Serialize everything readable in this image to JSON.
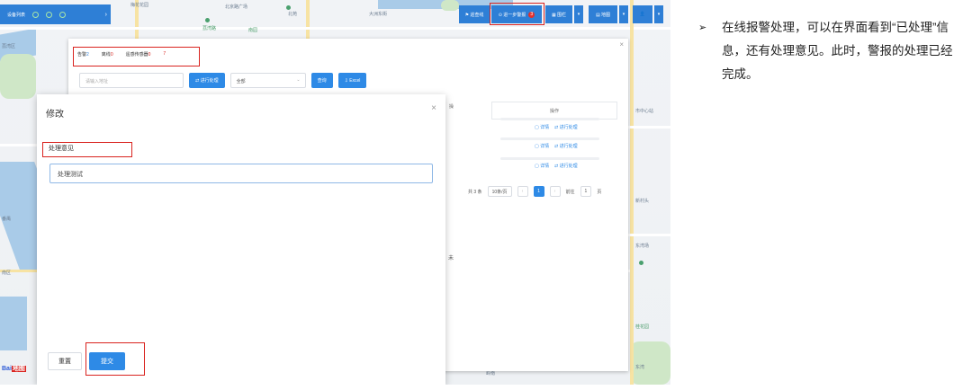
{
  "topbar": {
    "left_title": "设备列表",
    "left_chevron": "›",
    "btn_route": "⚑ 巡查线",
    "btn_alarm": "⊙ 进一步警报",
    "alarm_badge": "3",
    "btn_fence": "▦ 围栏",
    "btn_layers": "▤ 地图",
    "btn_user": "👤"
  },
  "map_labels": [
    "梅花花园",
    "北京路广场",
    "北苑",
    "大洲东街",
    "荔湾路",
    "荔湾区",
    "南园",
    "市中心站",
    "新村头",
    "东湾场",
    "桂花园",
    "番禺",
    "南区",
    "岭南",
    "东湾"
  ],
  "panel": {
    "tabs": [
      {
        "label": "告警",
        "count": "2"
      },
      {
        "label": "离线",
        "count": "0"
      },
      {
        "label": "遥感传感器",
        "count": "0"
      }
    ],
    "tab_extra": "7",
    "search_placeholder": "请输入地址",
    "btn_process": "⇄ 进行处理",
    "select_value": "全部",
    "btn_query": "查询",
    "btn_export": "⇩ Excel",
    "header_left": "操",
    "header_action": "操作",
    "row_actions": [
      {
        "detail": "▢ 详情",
        "process": "⇄ 进行处理"
      },
      {
        "detail": "▢ 详情",
        "process": "⇄ 进行处理"
      },
      {
        "detail": "▢ 详情",
        "process": "⇄ 进行处理"
      }
    ],
    "pager": {
      "total": "共 3 条",
      "page_size": "10条/页",
      "current": "1",
      "goto_label": "前往",
      "goto_value": "1",
      "page_unit": "页"
    },
    "close": "×"
  },
  "modal": {
    "title": "修改",
    "close": "×",
    "field_label": "处理意见",
    "field_value": "处理测试",
    "btn_reset": "重置",
    "btn_submit": "提交"
  },
  "stray_text": "未",
  "baidu_logo": "Bai",
  "baidu_logo_red": "地图",
  "annotation": {
    "bullet": "➢",
    "text": "在线报警处理，可以在界面看到“已处理”信息，还有处理意见。此时，警报的处理已经完成。"
  }
}
